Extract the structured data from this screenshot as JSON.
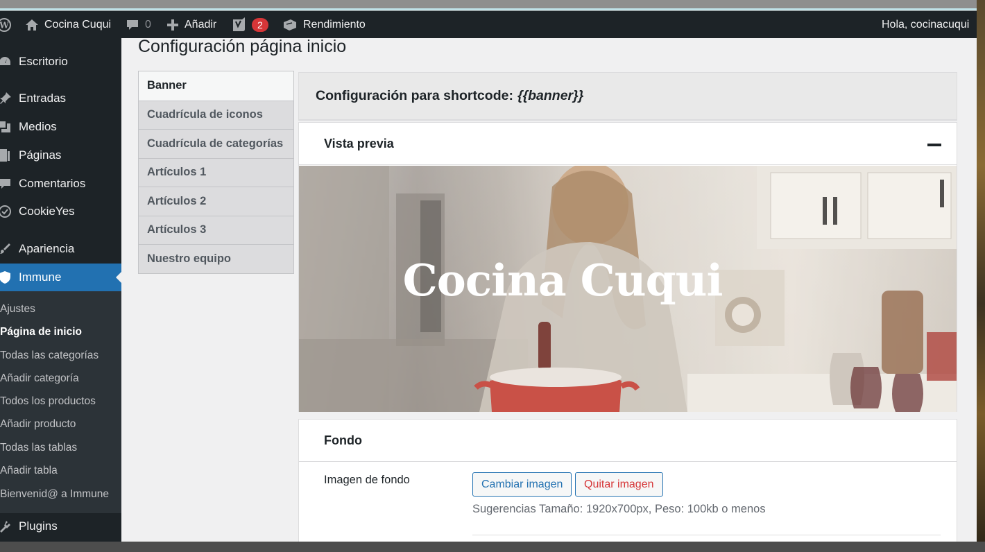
{
  "adminbar": {
    "site_name": "Cocina Cuqui",
    "comments_count": "0",
    "add_label": "Añadir",
    "yoast_badge": "2",
    "performance_label": "Rendimiento",
    "greeting": "Hola, cocinacuqui"
  },
  "sidebar": {
    "items": [
      {
        "label": "Escritorio",
        "icon": "dashboard-icon"
      },
      {
        "label": "Entradas",
        "icon": "pin-icon"
      },
      {
        "label": "Medios",
        "icon": "media-icon"
      },
      {
        "label": "Páginas",
        "icon": "page-icon"
      },
      {
        "label": "Comentarios",
        "icon": "comment-icon"
      },
      {
        "label": "CookieYes",
        "icon": "cookie-icon"
      },
      {
        "label": "Apariencia",
        "icon": "brush-icon"
      },
      {
        "label": "Immune",
        "icon": "shield-icon"
      },
      {
        "label": "Plugins",
        "icon": "plugin-icon"
      }
    ],
    "submenu": [
      "Ajustes",
      "Página de inicio",
      "Todas las categorías",
      "Añadir categoría",
      "Todos los productos",
      "Añadir producto",
      "Todas las tablas",
      "Añadir tabla",
      "Bienvenid@ a Immune"
    ]
  },
  "page": {
    "title": "Configuración página inicio"
  },
  "tabs": [
    "Banner",
    "Cuadrícula de iconos",
    "Cuadrícula de categorías",
    "Artículos 1",
    "Artículos 2",
    "Artículos 3",
    "Nuestro equipo"
  ],
  "panel": {
    "heading_prefix": "Configuración para shortcode:",
    "heading_code": "{{banner}}",
    "preview_label": "Vista previa",
    "banner_title": "Cocina Cuqui",
    "fondo_label": "Fondo",
    "image_field_label": "Imagen de fondo",
    "change_button": "Cambiar imagen",
    "remove_button": "Quitar imagen",
    "hint": "Sugerencias Tamaño: 1920x700px, Peso: 100kb o menos"
  },
  "colors": {
    "admin_dark": "#1d2327",
    "accent_blue": "#2271b1",
    "badge_red": "#d63638"
  }
}
